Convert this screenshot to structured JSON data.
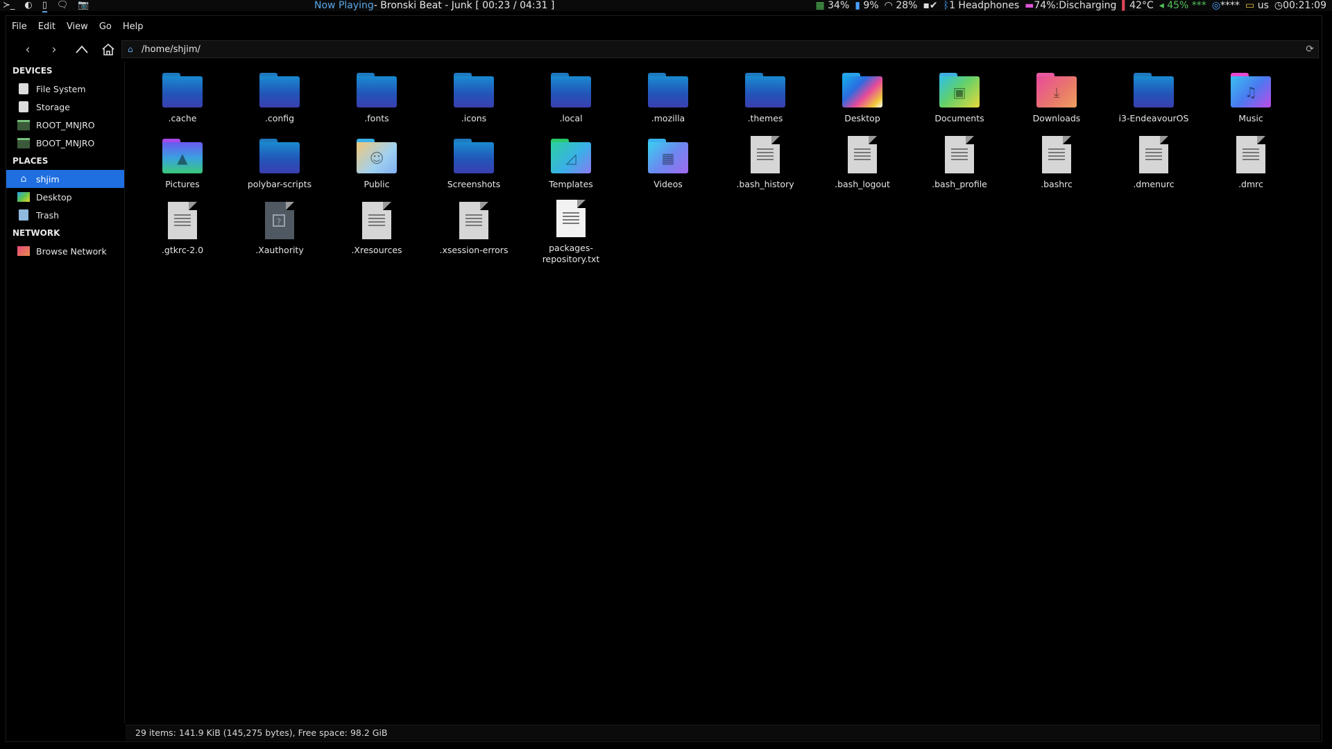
{
  "polybar": {
    "workspaces": [
      "≻_",
      "◐",
      "▯",
      "🗨",
      "📷"
    ],
    "now_playing_label": "Now Playing",
    "now_playing_rest": "- Bronski Beat -  Junk  [ 00:23 / 04:31 ]",
    "cpu": "34%",
    "ram": "9%",
    "wifi": "28%",
    "bluetooth": "1 Headphones",
    "battery": "74%:Discharging",
    "temp": "42°C",
    "volume": "45% ***",
    "volume_extra": "****",
    "kbd": "us",
    "clock": "00:21:09"
  },
  "menu": [
    "File",
    "Edit",
    "View",
    "Go",
    "Help"
  ],
  "location": {
    "path": "/home/shjim/"
  },
  "sidebar": {
    "devices_title": "DEVICES",
    "devices": [
      {
        "label": "File System",
        "icon": "drive-icon"
      },
      {
        "label": "Storage",
        "icon": "drive-icon"
      },
      {
        "label": "ROOT_MNJRO",
        "icon": "partition-icon"
      },
      {
        "label": "BOOT_MNJRO",
        "icon": "partition-icon"
      }
    ],
    "places_title": "PLACES",
    "places": [
      {
        "label": "shjim",
        "icon": "home-icon",
        "selected": true
      },
      {
        "label": "Desktop",
        "icon": "desktop-icon"
      },
      {
        "label": "Trash",
        "icon": "trash-icon"
      }
    ],
    "network_title": "NETWORK",
    "network": [
      {
        "label": "Browse Network",
        "icon": "network-icon"
      }
    ]
  },
  "files": [
    {
      "name": ".cache",
      "kind": "folder"
    },
    {
      "name": ".config",
      "kind": "folder"
    },
    {
      "name": ".fonts",
      "kind": "folder"
    },
    {
      "name": ".icons",
      "kind": "folder"
    },
    {
      "name": ".local",
      "kind": "folder"
    },
    {
      "name": ".mozilla",
      "kind": "folder"
    },
    {
      "name": ".themes",
      "kind": "folder"
    },
    {
      "name": "Desktop",
      "kind": "desktop"
    },
    {
      "name": "Documents",
      "kind": "documents"
    },
    {
      "name": "Downloads",
      "kind": "downloads"
    },
    {
      "name": "i3-EndeavourOS",
      "kind": "folder"
    },
    {
      "name": "Music",
      "kind": "music"
    },
    {
      "name": "Pictures",
      "kind": "pictures"
    },
    {
      "name": "polybar-scripts",
      "kind": "folder"
    },
    {
      "name": "Public",
      "kind": "public"
    },
    {
      "name": "Screenshots",
      "kind": "folder"
    },
    {
      "name": "Templates",
      "kind": "templates"
    },
    {
      "name": "Videos",
      "kind": "videos"
    },
    {
      "name": ".bash_history",
      "kind": "text"
    },
    {
      "name": ".bash_logout",
      "kind": "text"
    },
    {
      "name": ".bash_profile",
      "kind": "text"
    },
    {
      "name": ".bashrc",
      "kind": "text"
    },
    {
      "name": ".dmenurc",
      "kind": "text"
    },
    {
      "name": ".dmrc",
      "kind": "text"
    },
    {
      "name": ".gtkrc-2.0",
      "kind": "text"
    },
    {
      "name": ".Xauthority",
      "kind": "unknown"
    },
    {
      "name": ".Xresources",
      "kind": "text"
    },
    {
      "name": ".xsession-errors",
      "kind": "text"
    },
    {
      "name": "packages-repository.txt",
      "kind": "textwhite"
    }
  ],
  "status": "29 items: 141.9 KiB (145,275 bytes), Free space: 98.2 GiB"
}
